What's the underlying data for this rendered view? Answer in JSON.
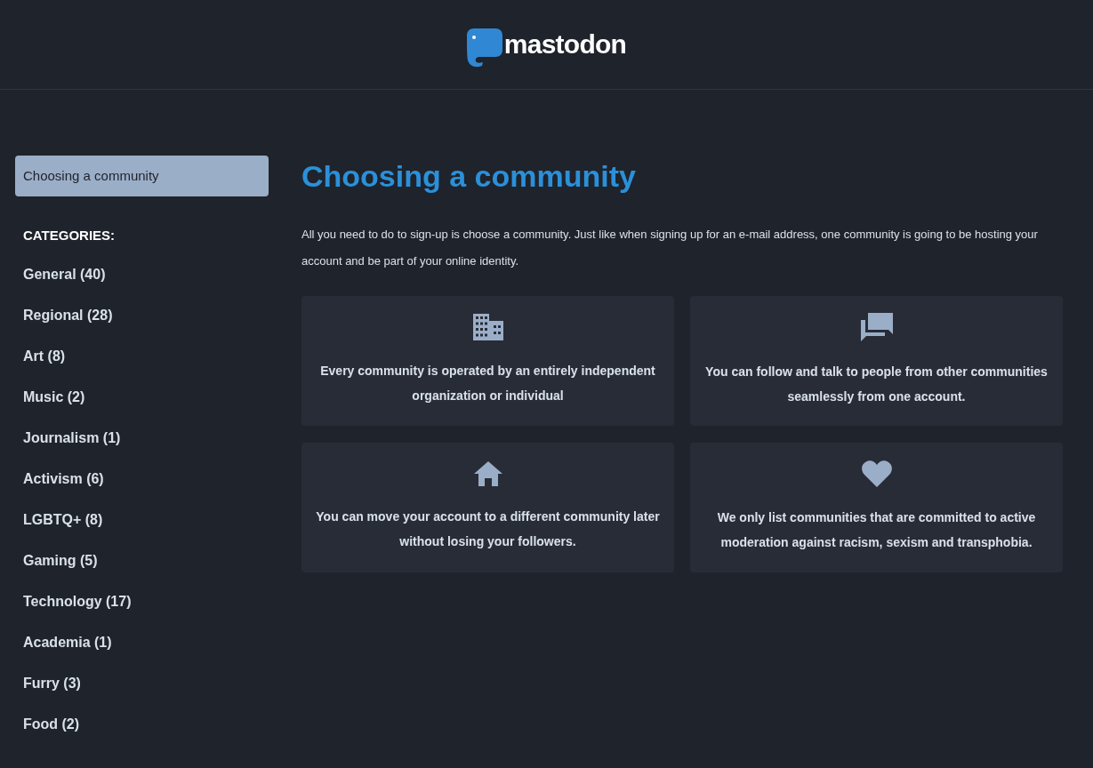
{
  "header": {
    "logo_text": "mastodon"
  },
  "sidebar": {
    "items": [
      {
        "label": "Choosing a community",
        "selected": true
      }
    ],
    "categories_heading": "CATEGORIES:",
    "categories": [
      {
        "label": "General (40)"
      },
      {
        "label": "Regional (28)"
      },
      {
        "label": "Art (8)"
      },
      {
        "label": "Music (2)"
      },
      {
        "label": "Journalism (1)"
      },
      {
        "label": "Activism (6)"
      },
      {
        "label": "LGBTQ+ (8)"
      },
      {
        "label": "Gaming (5)"
      },
      {
        "label": "Technology (17)"
      },
      {
        "label": "Academia (1)"
      },
      {
        "label": "Furry (3)"
      },
      {
        "label": "Food (2)"
      }
    ]
  },
  "main": {
    "title": "Choosing a community",
    "intro": "All you need to do to sign-up is choose a community. Just like when signing up for an e-mail address, one community is going to be hosting your account and be part of your online identity.",
    "cards": [
      {
        "text": "Every community is operated by an entirely independent organization or individual"
      },
      {
        "text": "You can follow and talk to people from other communities seamlessly from one account."
      },
      {
        "text": "You can move your account to a different community later without losing your followers."
      },
      {
        "text": "We only list communities that are committed to active moderation against racism, sexism and transphobia."
      }
    ]
  }
}
